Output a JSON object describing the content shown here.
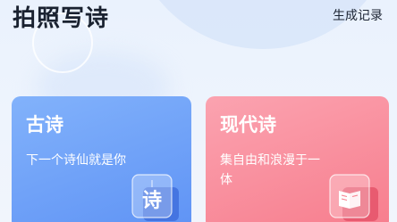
{
  "header": {
    "title": "拍照写诗",
    "history_label": "生成记录"
  },
  "cards": [
    {
      "title": "古诗",
      "description": "下一个诗仙就是你",
      "icon": "poem-character-icon",
      "icon_glyph": "诗",
      "color_start": "#82b2fb",
      "color_end": "#5f93f5"
    },
    {
      "title": "现代诗",
      "description": "集自由和浪漫于一体",
      "icon": "open-book-icon",
      "color_start": "#fba3b0",
      "color_end": "#f77d8d"
    }
  ]
}
